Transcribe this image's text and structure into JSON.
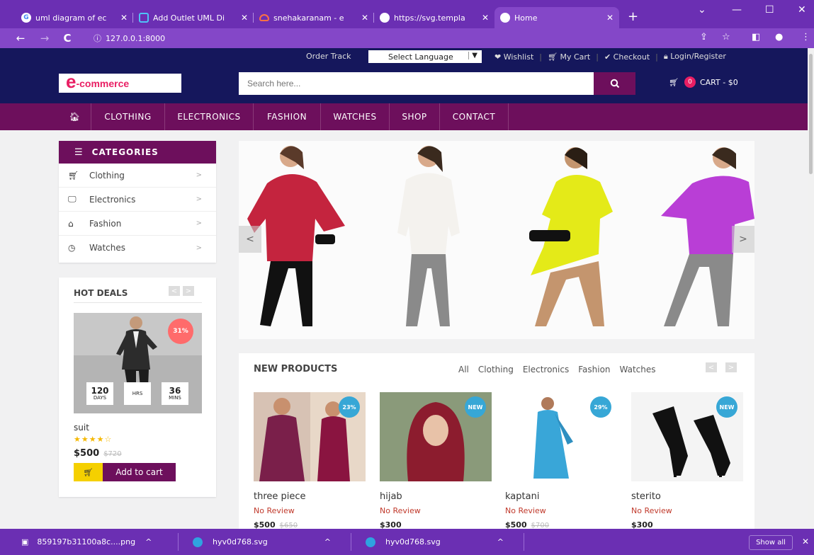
{
  "browser": {
    "tabs": [
      {
        "label": "uml diagram of ec",
        "icon": "google-icon"
      },
      {
        "label": "Add Outlet UML Di",
        "icon": "outlet-icon"
      },
      {
        "label": "snehakaranam - e",
        "icon": "cloud-icon"
      },
      {
        "label": "https://svg.templa",
        "icon": "globe-icon"
      },
      {
        "label": "Home",
        "icon": "globe-icon"
      }
    ],
    "new_tab": "+",
    "url": "127.0.0.1:8000"
  },
  "header": {
    "order_track": "Order Track",
    "language": "Select Language",
    "wishlist": "Wishlist",
    "my_cart": "My Cart",
    "checkout": "Checkout",
    "login": "Login/Register",
    "logo_text": "-commerce",
    "logo_letter": "e",
    "search_placeholder": "Search here...",
    "cart_count": "0",
    "cart_label": "CART - $0"
  },
  "nav": {
    "home_icon": "home-icon",
    "items": [
      "CLOTHING",
      "ELECTRONICS",
      "FASHION",
      "WATCHES",
      "SHOP",
      "CONTACT"
    ]
  },
  "categories": {
    "title": "CATEGORIES",
    "items": [
      {
        "label": "Clothing",
        "icon": "cart-icon"
      },
      {
        "label": "Electronics",
        "icon": "monitor-icon"
      },
      {
        "label": "Fashion",
        "icon": "shop-icon"
      },
      {
        "label": "Watches",
        "icon": "clock-icon"
      }
    ],
    "chevron": ">"
  },
  "hot_deals": {
    "title": "HOT DEALS",
    "discount": "31%",
    "countdown": [
      {
        "value": "120",
        "label": "DAYS"
      },
      {
        "value": "",
        "label": "HRS"
      },
      {
        "value": "36",
        "label": "MINS"
      }
    ],
    "name": "suit",
    "stars": "★★★★☆",
    "price": "$500",
    "old_price": "$720",
    "add_to_cart": "Add to cart"
  },
  "new_products": {
    "title": "NEW PRODUCTS",
    "tabs": [
      "All",
      "Clothing",
      "Electronics",
      "Fashion",
      "Watches"
    ],
    "products": [
      {
        "name": "three piece",
        "review": "No Review",
        "price": "$500",
        "old_price": "$650",
        "tag": "23%"
      },
      {
        "name": "hijab",
        "review": "No Review",
        "price": "$300",
        "old_price": "",
        "tag": "NEW"
      },
      {
        "name": "kaptani",
        "review": "No Review",
        "price": "$500",
        "old_price": "$700",
        "tag": "29%"
      },
      {
        "name": "sterito",
        "review": "No Review",
        "price": "$300",
        "old_price": "",
        "tag": "NEW"
      }
    ]
  },
  "downloads": {
    "items": [
      "859197b31100a8c....png",
      "hyv0d768.svg",
      "hyv0d768.svg"
    ],
    "show_all": "Show all"
  },
  "colors": {
    "browser_purple": "#6b2fb3",
    "header_navy": "#15175c",
    "nav_maroon": "#6d0f5c",
    "accent_pink": "#e91e63",
    "tag_blue": "#37a7d6",
    "deal_red": "#ff6b6b"
  }
}
